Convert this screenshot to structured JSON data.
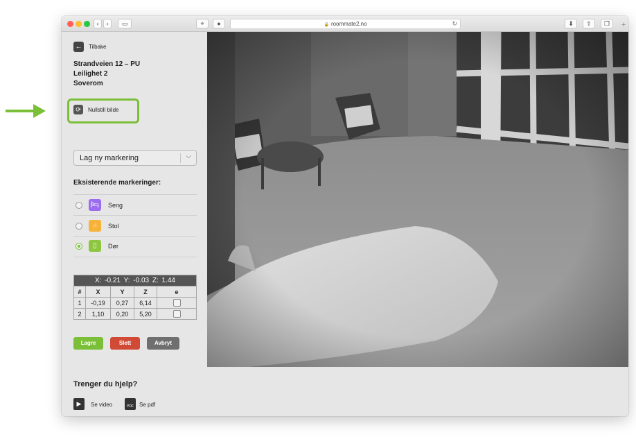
{
  "browser": {
    "url": "roommate2.no"
  },
  "sidebar": {
    "back_label": "Tilbake",
    "location": {
      "address": "Strandveien 12 – PU",
      "unit": "Leilighet 2",
      "room": "Soverom"
    },
    "reset_label": "Nullstill bilde",
    "new_marking_select": "Lag ny markering",
    "existing_title": "Eksisterende markeringer:",
    "markings": [
      {
        "label": "Seng",
        "color": "#9b6cf0",
        "icon": "bed-icon",
        "selected": false
      },
      {
        "label": "Stol",
        "color": "#f7b23a",
        "icon": "chair-icon",
        "selected": false
      },
      {
        "label": "Dør",
        "color": "#8dc63f",
        "icon": "door-icon",
        "selected": true
      }
    ],
    "coords": {
      "header": "X: -0.21   Y: -0.03   Z: 1.44",
      "columns": [
        "#",
        "X",
        "Y",
        "Z",
        "e"
      ],
      "rows": [
        {
          "n": "1",
          "x": "-0,19",
          "y": "0,27",
          "z": "6,14"
        },
        {
          "n": "2",
          "x": "1,10",
          "y": "0,20",
          "z": "5,20"
        }
      ]
    },
    "buttons": {
      "save": "Lagre",
      "delete": "Slett",
      "cancel": "Avbryt"
    },
    "help": {
      "title": "Trenger du hjelp?",
      "video": "Se video",
      "pdf": "Se pdf",
      "pdf_badge": "PDF"
    }
  },
  "colors": {
    "highlight": "#7bbf38",
    "save": "#7bbf38",
    "delete": "#d04a36",
    "cancel": "#6f6f6f"
  }
}
